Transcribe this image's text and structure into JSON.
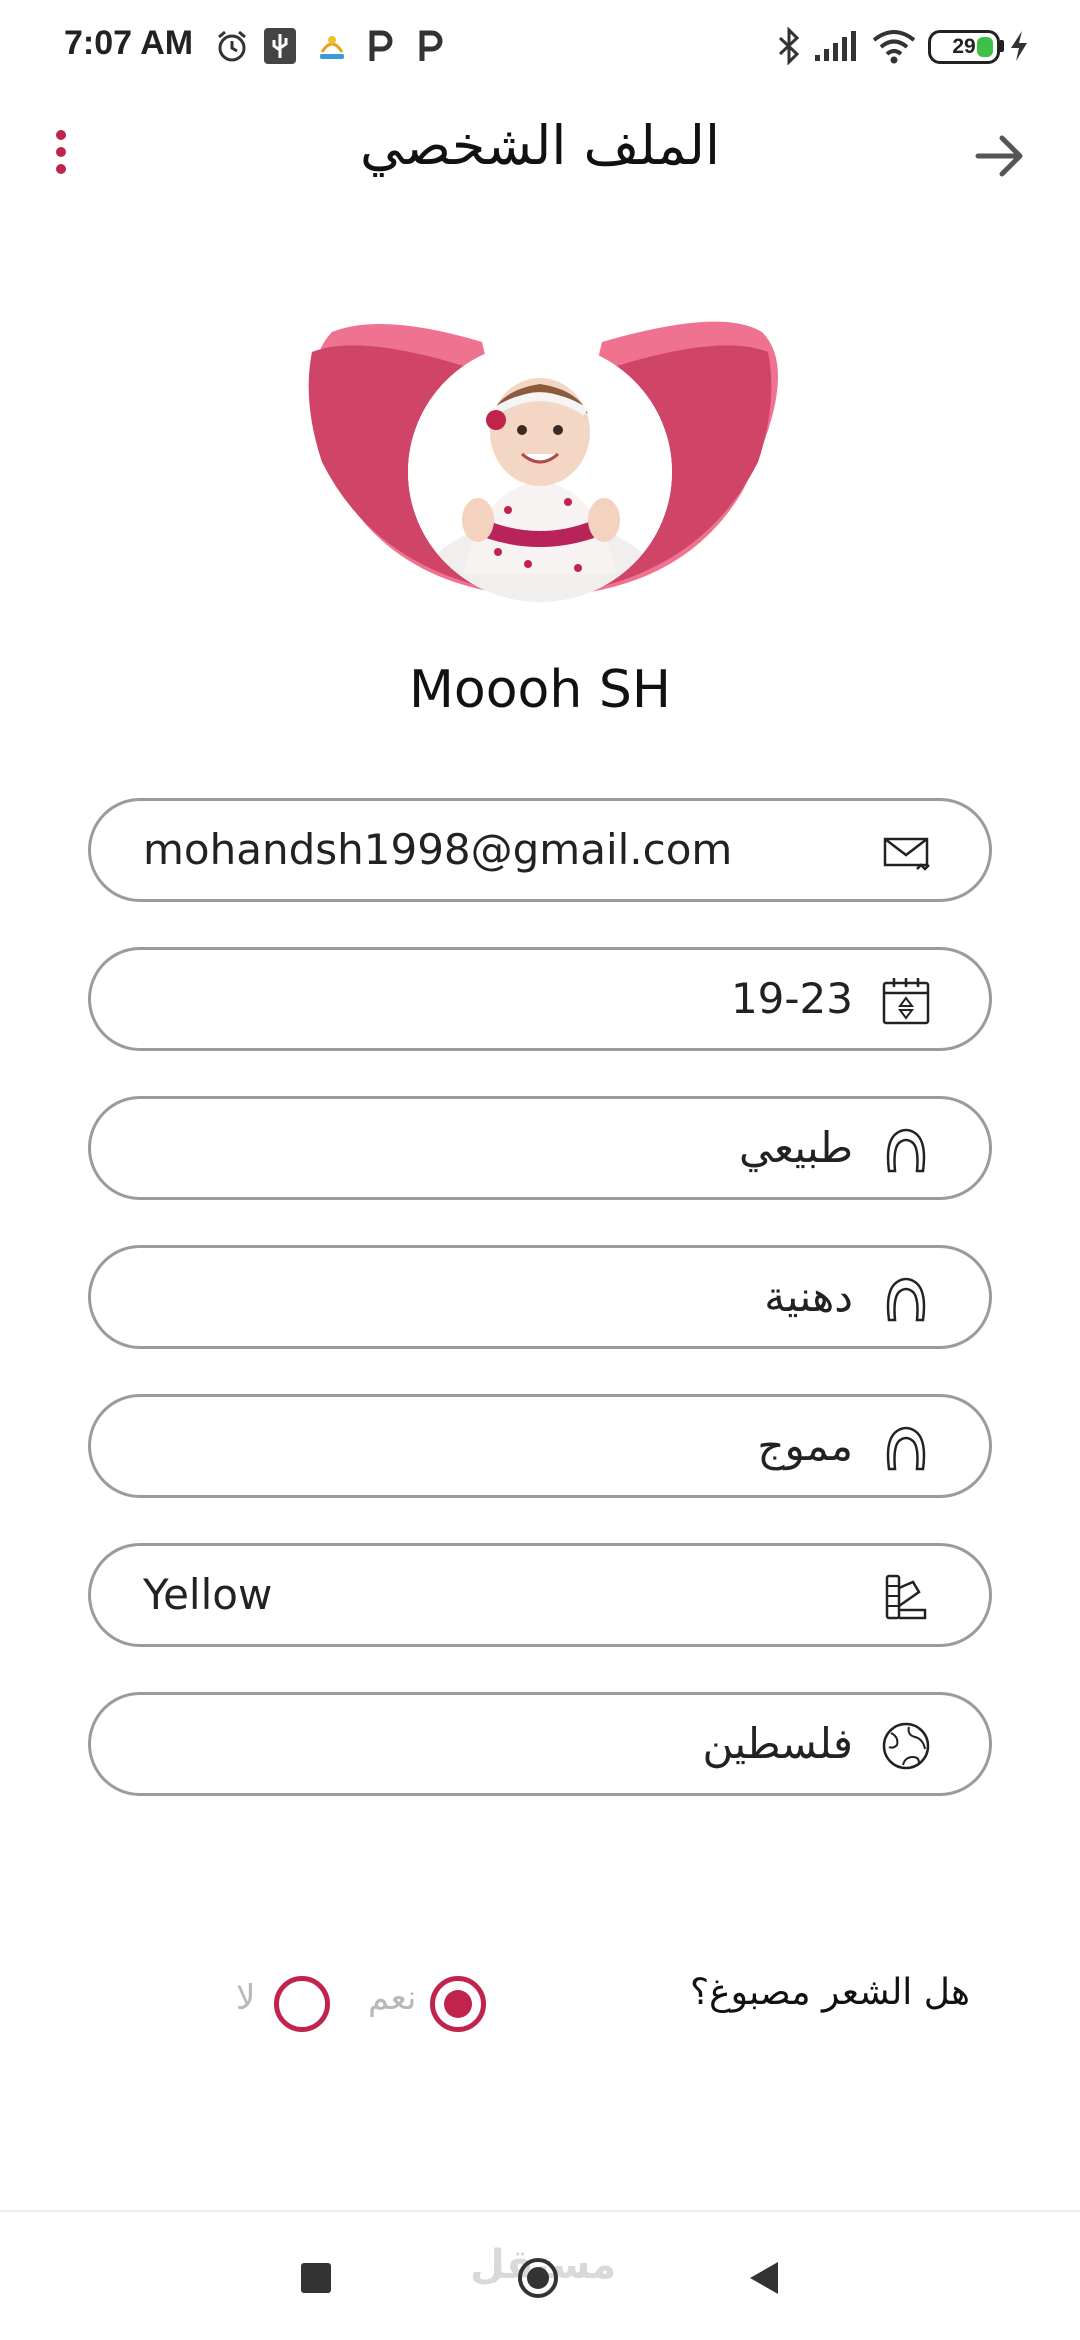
{
  "status_bar": {
    "time": "7:07 AM",
    "battery_level": "29",
    "icons": [
      "alarm-icon",
      "usb-icon",
      "app-notification-icon",
      "parking-icon",
      "parking-icon",
      "bluetooth-icon",
      "signal-icon",
      "wifi-icon",
      "battery-icon",
      "charging-icon"
    ]
  },
  "header": {
    "title": "الملف الشخصي"
  },
  "profile": {
    "name": "Moooh SH"
  },
  "fields": {
    "email": "mohandsh1998@gmail.com",
    "birth": "19-23",
    "hair_type": "طبيعي",
    "scalp_type": "دهنية",
    "hair_texture": "مموج",
    "color": "Yellow",
    "country": "فلسطين"
  },
  "dyed_question": {
    "label": "هل الشعر مصبوغ؟",
    "yes_label": "نعم",
    "no_label": "لا",
    "selected": "نعم"
  },
  "nav_bar": {
    "watermark": "مستقل"
  },
  "colors": {
    "accent": "#c0234b",
    "avatar_pink_light": "#ee6f8c",
    "avatar_pink_dark": "#cf4467",
    "field_border": "#9b9b9b"
  }
}
